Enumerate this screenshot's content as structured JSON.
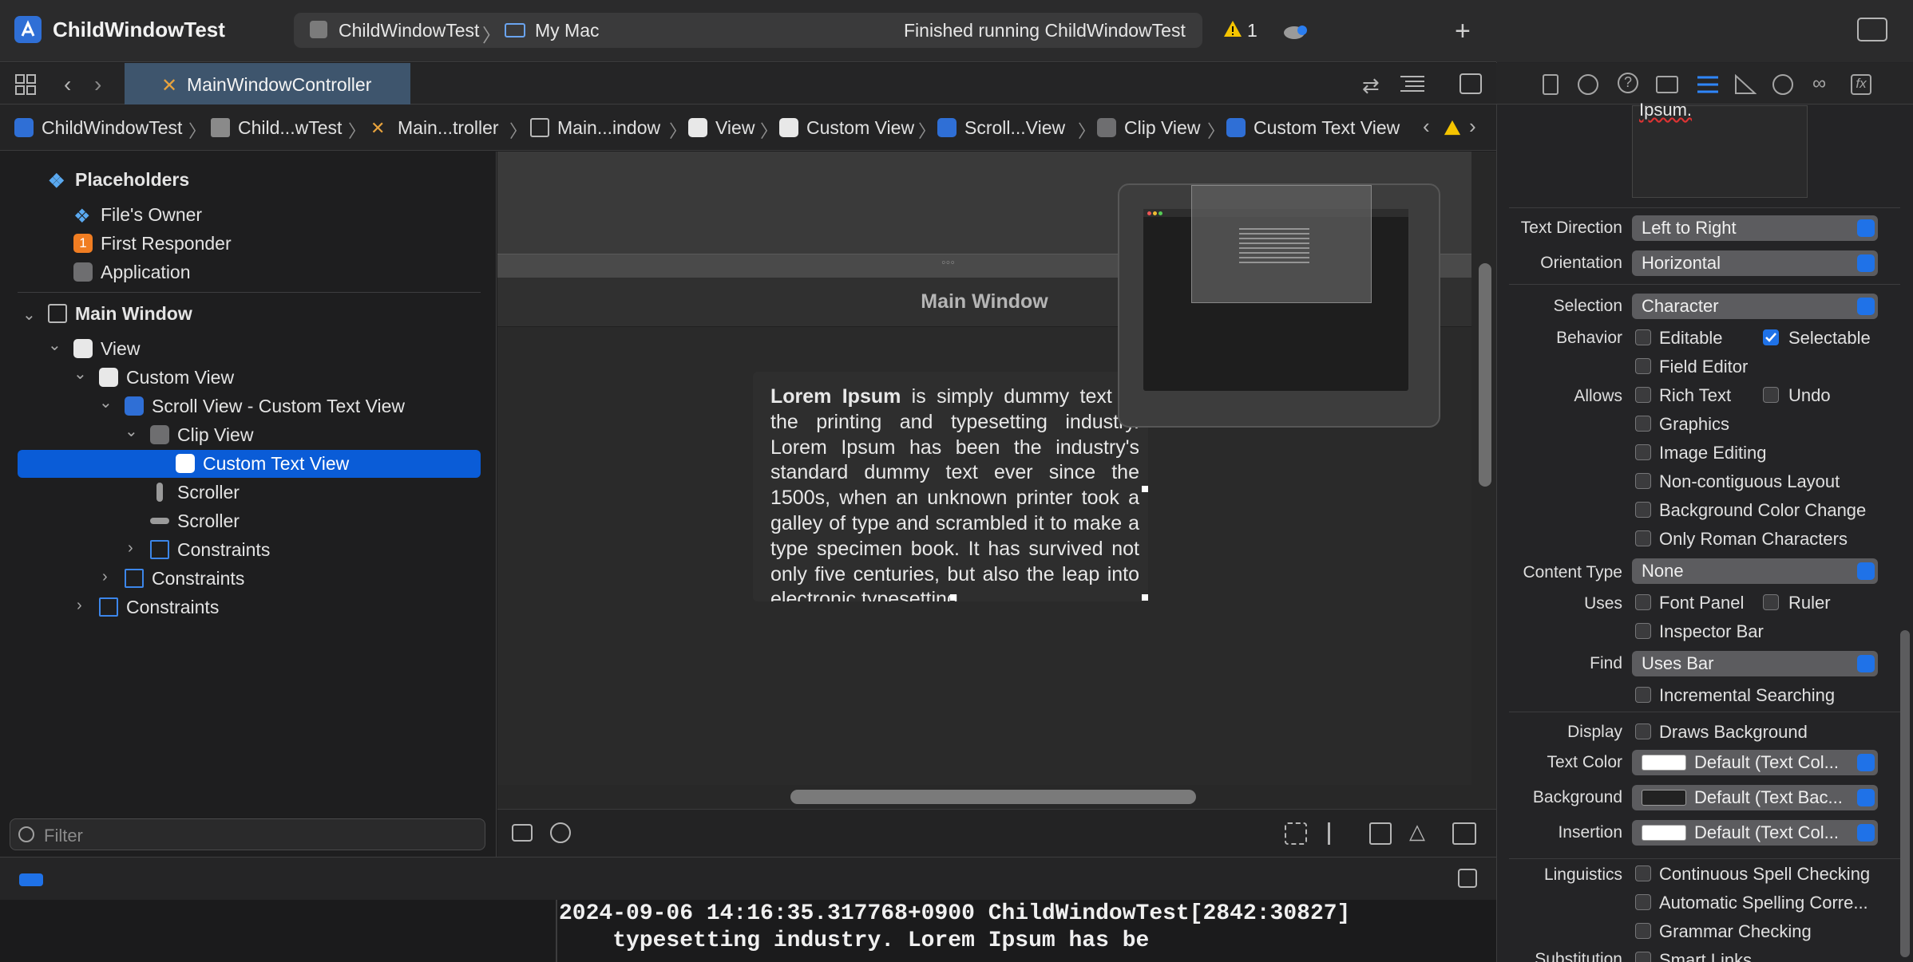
{
  "titlebar": {
    "project": "ChildWindowTest",
    "scheme": "ChildWindowTest",
    "destination": "My Mac",
    "status": "Finished running ChildWindowTest",
    "warnings": "1"
  },
  "tab": {
    "label": "MainWindowController"
  },
  "jumpbar": [
    "ChildWindowTest",
    "Child...wTest",
    "Main...troller",
    "Main...indow",
    "View",
    "Custom View",
    "Scroll...View",
    "Clip View",
    "Custom Text View"
  ],
  "outline": {
    "placeholders": "Placeholders",
    "files_owner": "File's Owner",
    "first_responder": "First Responder",
    "first_responder_badge": "1",
    "application": "Application",
    "main_window": "Main Window",
    "view": "View",
    "custom_view": "Custom View",
    "scroll_view": "Scroll View - Custom Text View",
    "clip_view": "Clip View",
    "custom_text_view": "Custom Text View",
    "scroller1": "Scroller",
    "scroller2": "Scroller",
    "constraints1": "Constraints",
    "constraints2": "Constraints",
    "constraints3": "Constraints",
    "filter_placeholder": "Filter"
  },
  "canvas": {
    "window_title": "Main Window",
    "lorem_bold": "Lorem Ipsum",
    "lorem_text": " is simply dummy text of the printing and typesetting industry. Lorem Ipsum has been the industry's standard dummy text ever since the 1500s, when an unknown printer took a galley of type and scrambled it to make a type specimen book. It has survived not only five centuries, but also the leap into electronic typesetting"
  },
  "console": {
    "line1": "2024-09-06 14:16:35.317768+0900 ChildWindowTest[2842:30827]",
    "line2": "    typesetting industry. Lorem Ipsum has be"
  },
  "inspector": {
    "top_text": "Ipsum.",
    "text_direction_label": "Text Direction",
    "text_direction": "Left to Right",
    "orientation_label": "Orientation",
    "orientation": "Horizontal",
    "selection_label": "Selection",
    "selection": "Character",
    "behavior_label": "Behavior",
    "editable": "Editable",
    "selectable": "Selectable",
    "field_editor": "Field Editor",
    "allows_label": "Allows",
    "rich_text": "Rich Text",
    "undo": "Undo",
    "graphics": "Graphics",
    "image_editing": "Image Editing",
    "noncontiguous": "Non-contiguous Layout",
    "bg_color_change": "Background Color Change",
    "only_roman": "Only Roman Characters",
    "content_type_label": "Content Type",
    "content_type": "None",
    "uses_label": "Uses",
    "font_panel": "Font Panel",
    "ruler": "Ruler",
    "inspector_bar": "Inspector Bar",
    "find_label": "Find",
    "find": "Uses Bar",
    "incremental": "Incremental Searching",
    "display_label": "Display",
    "draws_bg": "Draws Background",
    "text_color_label": "Text Color",
    "text_color": "Default (Text Col...",
    "background_label": "Background",
    "background": "Default (Text Bac...",
    "insertion_label": "Insertion",
    "insertion": "Default (Text Col...",
    "linguistics_label": "Linguistics",
    "spell": "Continuous Spell Checking",
    "auto_spell": "Automatic Spelling Corre...",
    "grammar": "Grammar Checking",
    "substitution_label": "Substitution",
    "smart_links": "Smart Links"
  },
  "colors": {
    "selection": "#0a5cd7",
    "accent": "#1f72e8",
    "warning": "#f5c400"
  }
}
